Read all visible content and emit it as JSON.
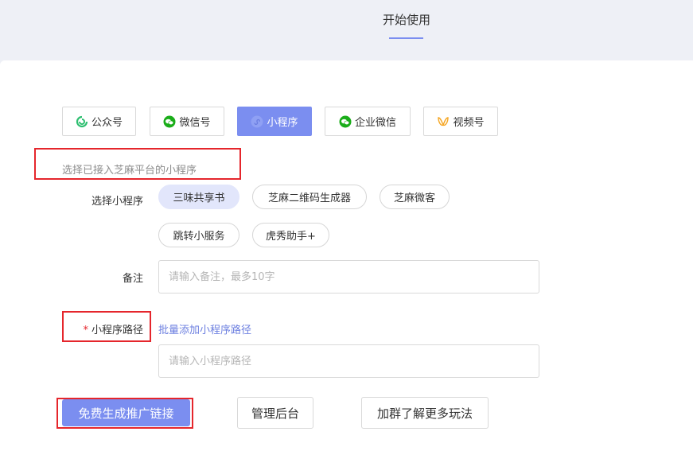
{
  "header": {
    "tab_label": "开始使用"
  },
  "platform_tabs": [
    {
      "label": "公众号",
      "icon": "official-account-icon",
      "active": false
    },
    {
      "label": "微信号",
      "icon": "wechat-icon",
      "active": false
    },
    {
      "label": "小程序",
      "icon": "mini-program-icon",
      "active": true
    },
    {
      "label": "企业微信",
      "icon": "wecom-icon",
      "active": false
    },
    {
      "label": "视频号",
      "icon": "channels-icon",
      "active": false
    }
  ],
  "form": {
    "hint": "选择已接入芝麻平台的小程序",
    "mini_program_label": "选择小程序",
    "mini_programs": [
      "三味共享书",
      "芝麻二维码生成器",
      "芝麻微客",
      "跳转小服务",
      "虎秀助手+"
    ],
    "selected_mini_program": "三味共享书",
    "note_label": "备注",
    "note_placeholder": "请输入备注，最多10字",
    "path_required_mark": "*",
    "path_label": "小程序路径",
    "batch_add_link": "批量添加小程序路径",
    "path_placeholder": "请输入小程序路径"
  },
  "actions": {
    "generate": "免费生成推广链接",
    "admin": "管理后台",
    "join_group": "加群了解更多玩法"
  },
  "colors": {
    "accent": "#7b8ef0",
    "highlight_box": "#e5262c",
    "chip_selected_bg": "#e2e6fb",
    "page_bg": "#eef0f6"
  }
}
